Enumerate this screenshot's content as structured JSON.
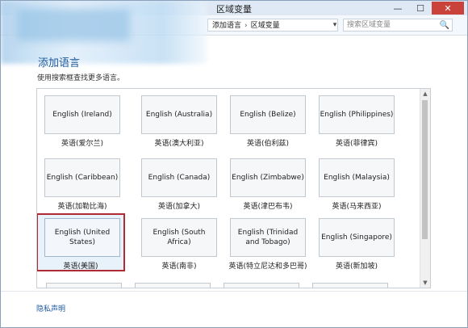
{
  "window": {
    "title": "区域变量",
    "controls": [
      "—",
      "☐",
      "✕"
    ]
  },
  "address": {
    "back_icon": "◀",
    "items": [
      "添加语言",
      "区域变量"
    ],
    "dropdown_icon": "▾",
    "refresh_icon": "↻"
  },
  "search": {
    "placeholder": "搜索区域变量",
    "icon": "🔍"
  },
  "page": {
    "heading": "添加语言",
    "instruction": "使用搜索框查找更多语言。"
  },
  "languages": [
    {
      "name": "English (Ireland)",
      "caption": "英语(爱尔兰)"
    },
    {
      "name": "English (Australia)",
      "caption": "英语(澳大利亚)"
    },
    {
      "name": "English (Belize)",
      "caption": "英语(伯利兹)"
    },
    {
      "name": "English (Philippines)",
      "caption": "英语(菲律宾)"
    },
    {
      "name": "English (Caribbean)",
      "caption": "英语(加勒比海)"
    },
    {
      "name": "English (Canada)",
      "caption": "英语(加拿大)"
    },
    {
      "name": "English (Zimbabwe)",
      "caption": "英语(津巴布韦)"
    },
    {
      "name": "English (Malaysia)",
      "caption": "英语(马来西亚)"
    },
    {
      "name": "English (United States)",
      "caption": "英语(美国)",
      "selected": true
    },
    {
      "name": "English (South Africa)",
      "caption": "英语(南非)"
    },
    {
      "name": "English (Trinidad and Tobago)",
      "caption": "英语(特立尼达和多巴哥)"
    },
    {
      "name": "English (Singapore)",
      "caption": "英语(新加坡)"
    }
  ],
  "footer": {
    "privacy_link": "隐私声明"
  },
  "colors": {
    "selected_border": "#b02a34",
    "link": "#1e5aa0"
  }
}
